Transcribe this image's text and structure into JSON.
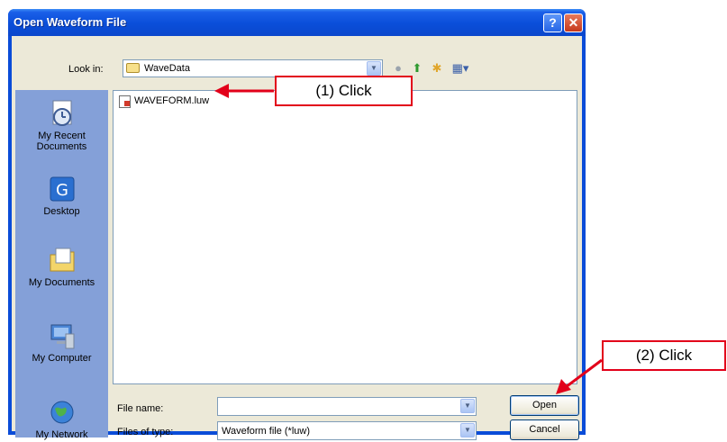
{
  "window": {
    "title": "Open Waveform File"
  },
  "lookin": {
    "label": "Look in:",
    "value": "WaveData"
  },
  "places": [
    {
      "label": "My Recent Documents"
    },
    {
      "label": "Desktop"
    },
    {
      "label": "My Documents"
    },
    {
      "label": "My Computer"
    },
    {
      "label": "My Network"
    }
  ],
  "files": [
    {
      "name": "WAVEFORM.luw"
    }
  ],
  "filename": {
    "label": "File name:",
    "value": ""
  },
  "filetype": {
    "label": "Files of type:",
    "value": "Waveform file (*luw)"
  },
  "buttons": {
    "open": "Open",
    "cancel": "Cancel"
  },
  "annotations": {
    "click1": "(1) Click",
    "click2": "(2) Click"
  },
  "colors": {
    "titlebar": "#0a4ed9",
    "places": "#84a0d8",
    "callout": "#e2001a"
  }
}
